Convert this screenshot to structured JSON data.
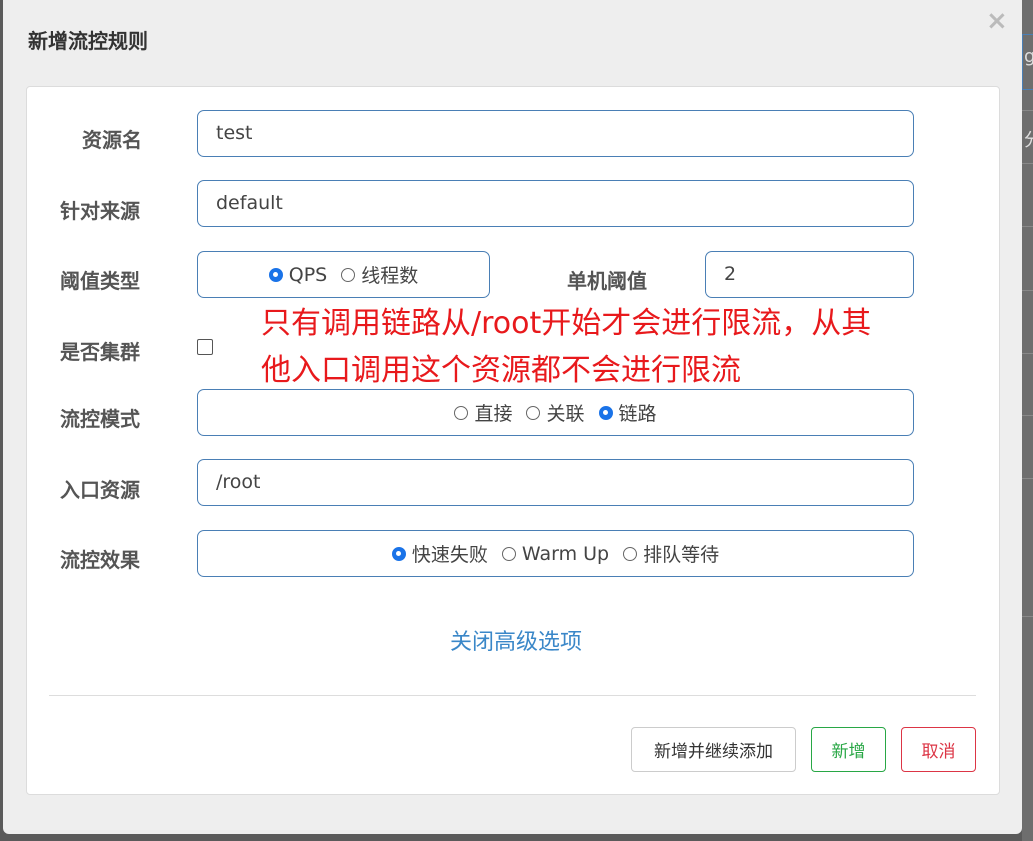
{
  "background": {
    "right_edge_fragment_1": "g",
    "right_edge_fragment_2": "分"
  },
  "dialog": {
    "title": "新增流控规则",
    "close_label": "×"
  },
  "form": {
    "resource_name": {
      "label": "资源名",
      "value": "test"
    },
    "limit_app": {
      "label": "针对来源",
      "value": "default"
    },
    "threshold_type": {
      "label": "阈值类型",
      "options": [
        {
          "label": "QPS",
          "checked": true
        },
        {
          "label": "线程数",
          "checked": false
        }
      ]
    },
    "single_threshold": {
      "label": "单机阈值",
      "value": "2"
    },
    "cluster": {
      "label": "是否集群",
      "checked": false
    },
    "control_mode": {
      "label": "流控模式",
      "options": [
        {
          "label": "直接",
          "checked": false
        },
        {
          "label": "关联",
          "checked": false
        },
        {
          "label": "链路",
          "checked": true
        }
      ]
    },
    "entry_resource": {
      "label": "入口资源",
      "value": "/root"
    },
    "control_effect": {
      "label": "流控效果",
      "options": [
        {
          "label": "快速失败",
          "checked": true
        },
        {
          "label": "Warm Up",
          "checked": false
        },
        {
          "label": "排队等待",
          "checked": false
        }
      ]
    },
    "advanced_toggle": "关闭高级选项"
  },
  "annotation": {
    "line1": "只有调用链路从/root开始才会进行限流，从其",
    "line2": "他入口调用这个资源都不会进行限流",
    "color": "#e8191c"
  },
  "buttons": {
    "add_continue": "新增并继续添加",
    "add": "新增",
    "cancel": "取消"
  },
  "colors": {
    "primary_border": "#4a7fb5",
    "link": "#3a87c8",
    "success": "#28a745",
    "danger": "#dc3545",
    "radio_checked": "#1a73e8"
  }
}
